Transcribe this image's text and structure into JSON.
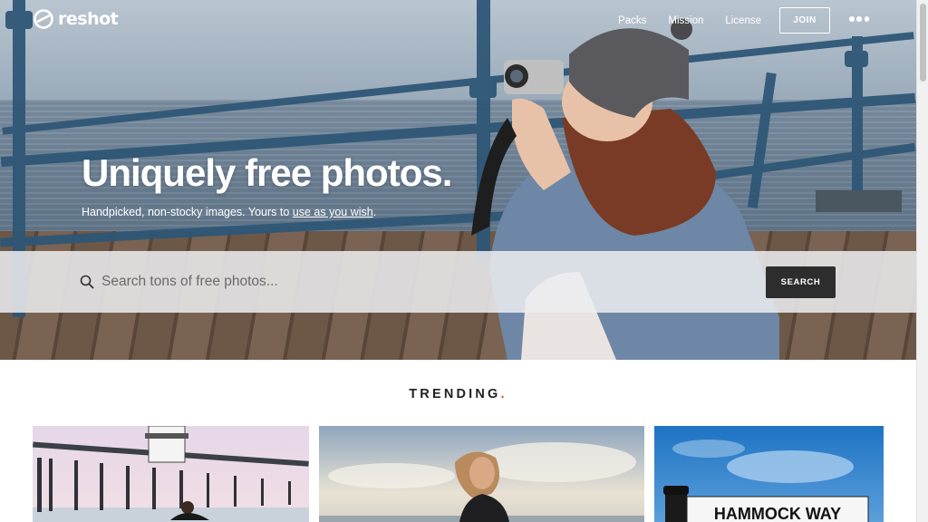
{
  "nav": {
    "brand": "reshot",
    "links": [
      "Packs",
      "Mission",
      "License"
    ],
    "join_label": "JOIN"
  },
  "hero": {
    "title": "Uniquely free photos.",
    "subtitle_prefix": "Handpicked, non-stocky images. Yours to ",
    "subtitle_link": "use as you wish",
    "subtitle_suffix": "."
  },
  "search": {
    "placeholder": "Search tons of free photos...",
    "button_label": "SEARCH"
  },
  "trending": {
    "heading": "TRENDING",
    "dot": ".",
    "cards": [
      {
        "subject": "pier-with-surfer"
      },
      {
        "subject": "woman-at-beach"
      },
      {
        "subject": "hammock-way-sign",
        "sign_text": "HAMMOCK WAY"
      }
    ]
  },
  "colors": {
    "accent_dot": "#e04a3f",
    "search_button": "#2d2d2d",
    "text_dark": "#222222"
  }
}
